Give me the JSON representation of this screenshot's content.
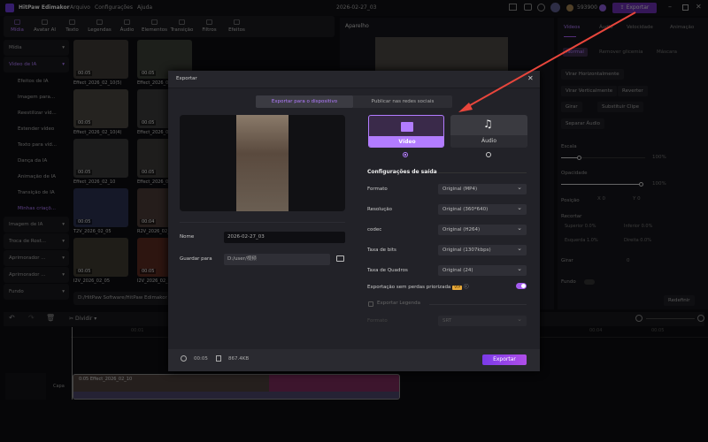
{
  "app": {
    "title": "HitPaw Edimakor",
    "menu": [
      "Arquivo",
      "Configurações",
      "Ajuda"
    ],
    "project_name": "2026-02-27_03",
    "credits": "593900",
    "export_label": "Exportar"
  },
  "toolbar": [
    {
      "label": "Mídia",
      "icon": "media-icon"
    },
    {
      "label": "Avatar AI",
      "icon": "avatar-icon"
    },
    {
      "label": "Texto",
      "icon": "text-icon"
    },
    {
      "label": "Legendas",
      "icon": "captions-icon"
    },
    {
      "label": "Áudio",
      "icon": "audio-icon"
    },
    {
      "label": "Elementos",
      "icon": "elements-icon"
    },
    {
      "label": "Transição",
      "icon": "transition-icon"
    },
    {
      "label": "Filtros",
      "icon": "filters-icon"
    },
    {
      "label": "Efeitos",
      "icon": "effects-icon"
    }
  ],
  "sidebar": [
    {
      "label": "Mídia",
      "type": "grp"
    },
    {
      "label": "Vídeo de IA",
      "type": "grp act"
    },
    {
      "label": "Efeitos de IA",
      "type": "sub"
    },
    {
      "label": "Imagem para...",
      "type": "sub"
    },
    {
      "label": "Reestilizar víd...",
      "type": "sub"
    },
    {
      "label": "Estender vídeo",
      "type": "sub"
    },
    {
      "label": "Texto para víd...",
      "type": "sub"
    },
    {
      "label": "Dança da IA",
      "type": "sub"
    },
    {
      "label": "Animação de IA",
      "type": "sub"
    },
    {
      "label": "Transição de IA",
      "type": "sub"
    },
    {
      "label": "Minhas criaçõ...",
      "type": "sub act"
    },
    {
      "label": "Imagem de IA",
      "type": "grp"
    },
    {
      "label": "Troca de Rost...",
      "type": "grp"
    },
    {
      "label": "Aprimorador ...",
      "type": "grp"
    },
    {
      "label": "Aprimorador ...",
      "type": "grp"
    },
    {
      "label": "Fundo",
      "type": "grp"
    }
  ],
  "media": [
    {
      "name": "Effect_2026_02_10(5)",
      "dur": "00:05"
    },
    {
      "name": "Effect_2026_02_10(6)",
      "dur": "00:05"
    },
    {
      "name": "Effect_2026_02_10(4)",
      "dur": "00:05"
    },
    {
      "name": "Effect_2026_02_10(3)",
      "dur": "00:05"
    },
    {
      "name": "Effect_2026_02_10",
      "dur": "00:05"
    },
    {
      "name": "Effect_2026_02_10(2)",
      "dur": "00:05"
    },
    {
      "name": "T2V_2026_02_05",
      "dur": "00:05"
    },
    {
      "name": "R2V_2026_02_05",
      "dur": "00:04"
    },
    {
      "name": "I2V_2026_02_05",
      "dur": "00:05"
    },
    {
      "name": "I2V_2026_02_05",
      "dur": "00:05"
    }
  ],
  "media_path": "D:/HitPaw Software/HitPaw Edimakor",
  "preview": {
    "title": "Aparelho"
  },
  "right": {
    "tabs": [
      "Vídeos",
      "Áudio",
      "Velocidade",
      "Animação"
    ],
    "subtabs": [
      "Normal",
      "Remover glicemia",
      "Máscara"
    ],
    "buttons": [
      "Virar Horizontalmente",
      "Virar Verticalmente",
      "Reverter",
      "Girar",
      "Substituir Clipe",
      "Separar Áudio"
    ],
    "scale_label": "Escala",
    "scale_value": "100%",
    "opacity_label": "Opacidade",
    "opacity_value": "100%",
    "position_label": "Posição",
    "x_label": "X",
    "x": "0",
    "y_label": "Y",
    "y": "0",
    "crop_label": "Recortar",
    "crop": [
      {
        "label": "Superior",
        "value": "0.0%"
      },
      {
        "label": "Inferior",
        "value": "0.0%"
      },
      {
        "label": "Esquerda",
        "value": "1.0%"
      },
      {
        "label": "Direita",
        "value": "0.0%"
      }
    ],
    "rotate_label": "Girar",
    "rotate_value": "0",
    "background_label": "Fundo",
    "reset_label": "Redefinir"
  },
  "timeline": {
    "split_label": "Dividir",
    "ruler": [
      "00:01",
      "00:04",
      "00:05"
    ],
    "track_label": "Capa",
    "clip_label": "0:05  Effect_2026_02_10"
  },
  "dialog": {
    "title": "Exportar",
    "tabs": [
      "Exportar para o dispositivo",
      "Publicar nas redes sociais"
    ],
    "types": [
      {
        "label": "Vídeo",
        "selected": true
      },
      {
        "label": "Áudio",
        "selected": false
      }
    ],
    "name_label": "Nome",
    "name_value": "2026-02-27_03",
    "save_label": "Guardar para",
    "save_value": "D:/user/视频",
    "settings_title": "Configurações de saída",
    "settings": [
      {
        "label": "Formato",
        "value": "Original (MP4)"
      },
      {
        "label": "Resolução",
        "value": "Original (360*640)"
      },
      {
        "label": "codec",
        "value": "Original (H264)"
      },
      {
        "label": "Taxa de bits",
        "value": "Original (1307kbps)"
      },
      {
        "label": "Taxa de Quadros",
        "value": "Original (24)"
      }
    ],
    "lossless_label": "Exportação sem perdas priorizada",
    "vip": "VIP",
    "lossless_on": true,
    "subtitle_label": "Exportar Legenda",
    "subtitle_format_label": "Formato",
    "subtitle_format": "SRT",
    "duration": "00:05",
    "size": "867.4KB",
    "export_label": "Exportar"
  },
  "colors": {
    "accent": "#a55cf0",
    "arrow": "#e8463c"
  }
}
